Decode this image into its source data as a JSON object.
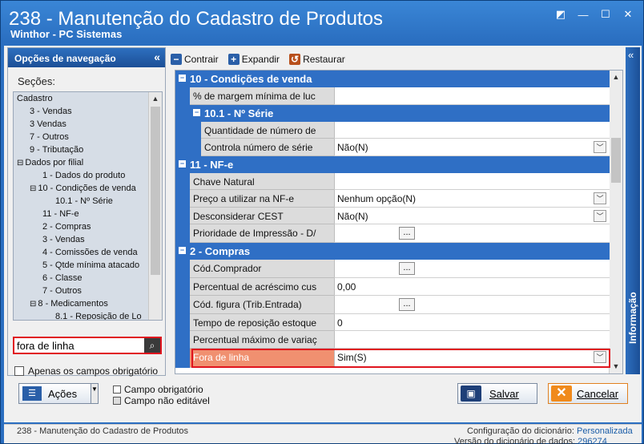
{
  "window": {
    "title": "238 - Manutenção do Cadastro de Produtos",
    "subtitle": "Winthor - PC Sistemas",
    "buttons": [
      "◩",
      "⬒",
      "—",
      "☐",
      "✕"
    ]
  },
  "nav": {
    "header": "Opções de navegação",
    "collapse": "«",
    "sections_label": "Seções:",
    "tree": [
      {
        "label": "Cadastro",
        "indent": 0,
        "toggle": ""
      },
      {
        "label": "3 - Vendas",
        "indent": 1,
        "toggle": ""
      },
      {
        "label": "3 Vendas",
        "indent": 1,
        "toggle": ""
      },
      {
        "label": "7 - Outros",
        "indent": 1,
        "toggle": ""
      },
      {
        "label": "9 - Tributação",
        "indent": 1,
        "toggle": ""
      },
      {
        "label": "Dados por filial",
        "indent": 0,
        "toggle": "⊟"
      },
      {
        "label": "1 - Dados do produto",
        "indent": 2,
        "toggle": ""
      },
      {
        "label": "10 - Condições de venda",
        "indent": 1,
        "toggle": "⊟"
      },
      {
        "label": "10.1 - Nº Série",
        "indent": 3,
        "toggle": ""
      },
      {
        "label": "11 - NF-e",
        "indent": 2,
        "toggle": ""
      },
      {
        "label": "2 - Compras",
        "indent": 2,
        "toggle": ""
      },
      {
        "label": "3 - Vendas",
        "indent": 2,
        "toggle": ""
      },
      {
        "label": "4 - Comissões de venda",
        "indent": 2,
        "toggle": ""
      },
      {
        "label": "5 - Qtde mínima atacado",
        "indent": 2,
        "toggle": ""
      },
      {
        "label": "6 - Classe",
        "indent": 2,
        "toggle": ""
      },
      {
        "label": "7 - Outros",
        "indent": 2,
        "toggle": ""
      },
      {
        "label": "8 - Medicamentos",
        "indent": 1,
        "toggle": "⊟"
      },
      {
        "label": "8.1 - Reposição de Lo",
        "indent": 3,
        "toggle": ""
      }
    ],
    "search": {
      "value": "fora de linha",
      "icon": "search-icon"
    },
    "required_only_label": "Apenas os campos obrigatório"
  },
  "toolbar": {
    "collapse_label": "Contrair",
    "expand_label": "Expandir",
    "restore_label": "Restaurar"
  },
  "grid": {
    "rows": [
      {
        "kind": "cat",
        "level": 1,
        "label": "10 - Condições de venda"
      },
      {
        "kind": "prop",
        "level": 1,
        "label": "% de margem mínima de luc",
        "value": "",
        "editor": "none"
      },
      {
        "kind": "cat",
        "level": 2,
        "label": "10.1 - Nº Série"
      },
      {
        "kind": "prop",
        "level": 2,
        "label": "Quantidade de número de",
        "value": "",
        "editor": "none"
      },
      {
        "kind": "prop",
        "level": 2,
        "label": "Controla número de série",
        "value": "Não(N)",
        "editor": "dropdown"
      },
      {
        "kind": "cat",
        "level": 1,
        "label": "11 - NF-e"
      },
      {
        "kind": "prop",
        "level": 1,
        "label": "Chave Natural",
        "value": "",
        "editor": "none"
      },
      {
        "kind": "prop",
        "level": 1,
        "label": "Preço a utilizar na NF-e",
        "value": "Nenhum opção(N)",
        "editor": "dropdown"
      },
      {
        "kind": "prop",
        "level": 1,
        "label": "Desconsiderar CEST",
        "value": "Não(N)",
        "editor": "dropdown"
      },
      {
        "kind": "prop",
        "level": 1,
        "label": "Prioridade de Impressão - D/",
        "value": "",
        "editor": "ellipsis"
      },
      {
        "kind": "cat",
        "level": 1,
        "label": "2 - Compras"
      },
      {
        "kind": "prop",
        "level": 1,
        "label": "Cód.Comprador",
        "value": "",
        "editor": "ellipsis"
      },
      {
        "kind": "prop",
        "level": 1,
        "label": "Percentual de acréscimo cus",
        "value": "0,00",
        "editor": "none"
      },
      {
        "kind": "prop",
        "level": 1,
        "label": "Cód. figura (Trib.Entrada)",
        "value": "",
        "editor": "ellipsis"
      },
      {
        "kind": "prop",
        "level": 1,
        "label": "Tempo de reposição estoque",
        "value": "0",
        "editor": "none"
      },
      {
        "kind": "prop",
        "level": 1,
        "label": "Percentual máximo de variaç",
        "value": "",
        "editor": "none"
      },
      {
        "kind": "prop",
        "level": 1,
        "label": "Fora de linha",
        "value": "Sim(S)",
        "editor": "dropdown",
        "highlight": true
      }
    ]
  },
  "info_panel": {
    "label": "Informação",
    "collapse": "«"
  },
  "footer": {
    "actions_label": "Ações",
    "legend_required": "Campo obrigatório",
    "legend_not_editable": "Campo não editável",
    "save_label": "Salvar",
    "cancel_label": "Cancelar"
  },
  "statusbar": {
    "left": "238 - Manutenção do Cadastro de Produtos",
    "dict_config_label": "Configuração do dicionário:",
    "dict_config_value": "Personalizada",
    "dict_version_label": "Versão do dicionário de dados:",
    "dict_version_value": "296274"
  }
}
